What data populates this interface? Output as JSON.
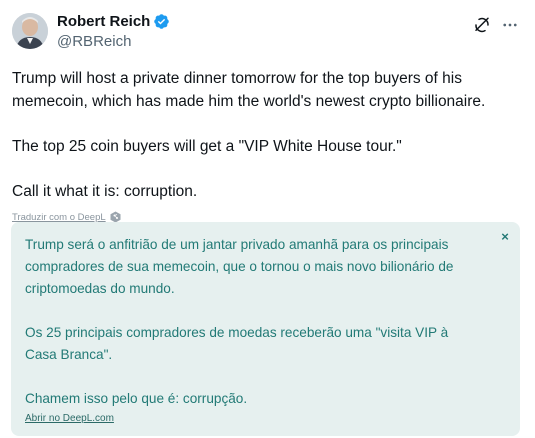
{
  "author": {
    "display_name": "Robert Reich",
    "handle": "@RBReich",
    "verified": true,
    "verified_color": "#1d9bf0"
  },
  "actions": {
    "grok_icon": "grok-icon",
    "more_icon": "more-icon"
  },
  "tweet": {
    "paragraphs": [
      "Trump will host a private dinner tomorrow for the top buyers of his memecoin, which has made him the world's newest crypto billionaire.",
      "The top 25 coin buyers will get a \"VIP White House tour.\"",
      "Call it what it is: corruption."
    ]
  },
  "translate": {
    "link_label": "Traduzir com o DeepL",
    "icon": "deepl-icon"
  },
  "translation": {
    "paragraphs": [
      "Trump será o anfitrião de um jantar privado amanhã para os principais compradores de sua memecoin, que o tornou o mais novo bilionário de criptomoedas do mundo.",
      "Os 25 principais compradores de moedas receberão uma \"visita VIP à Casa Branca\".",
      "Chamem isso pelo que é: corrupção."
    ],
    "close_label": "×",
    "open_link": "Abrir no DeepL.com",
    "background_color": "#e6f0ef",
    "text_color": "#227a76"
  }
}
